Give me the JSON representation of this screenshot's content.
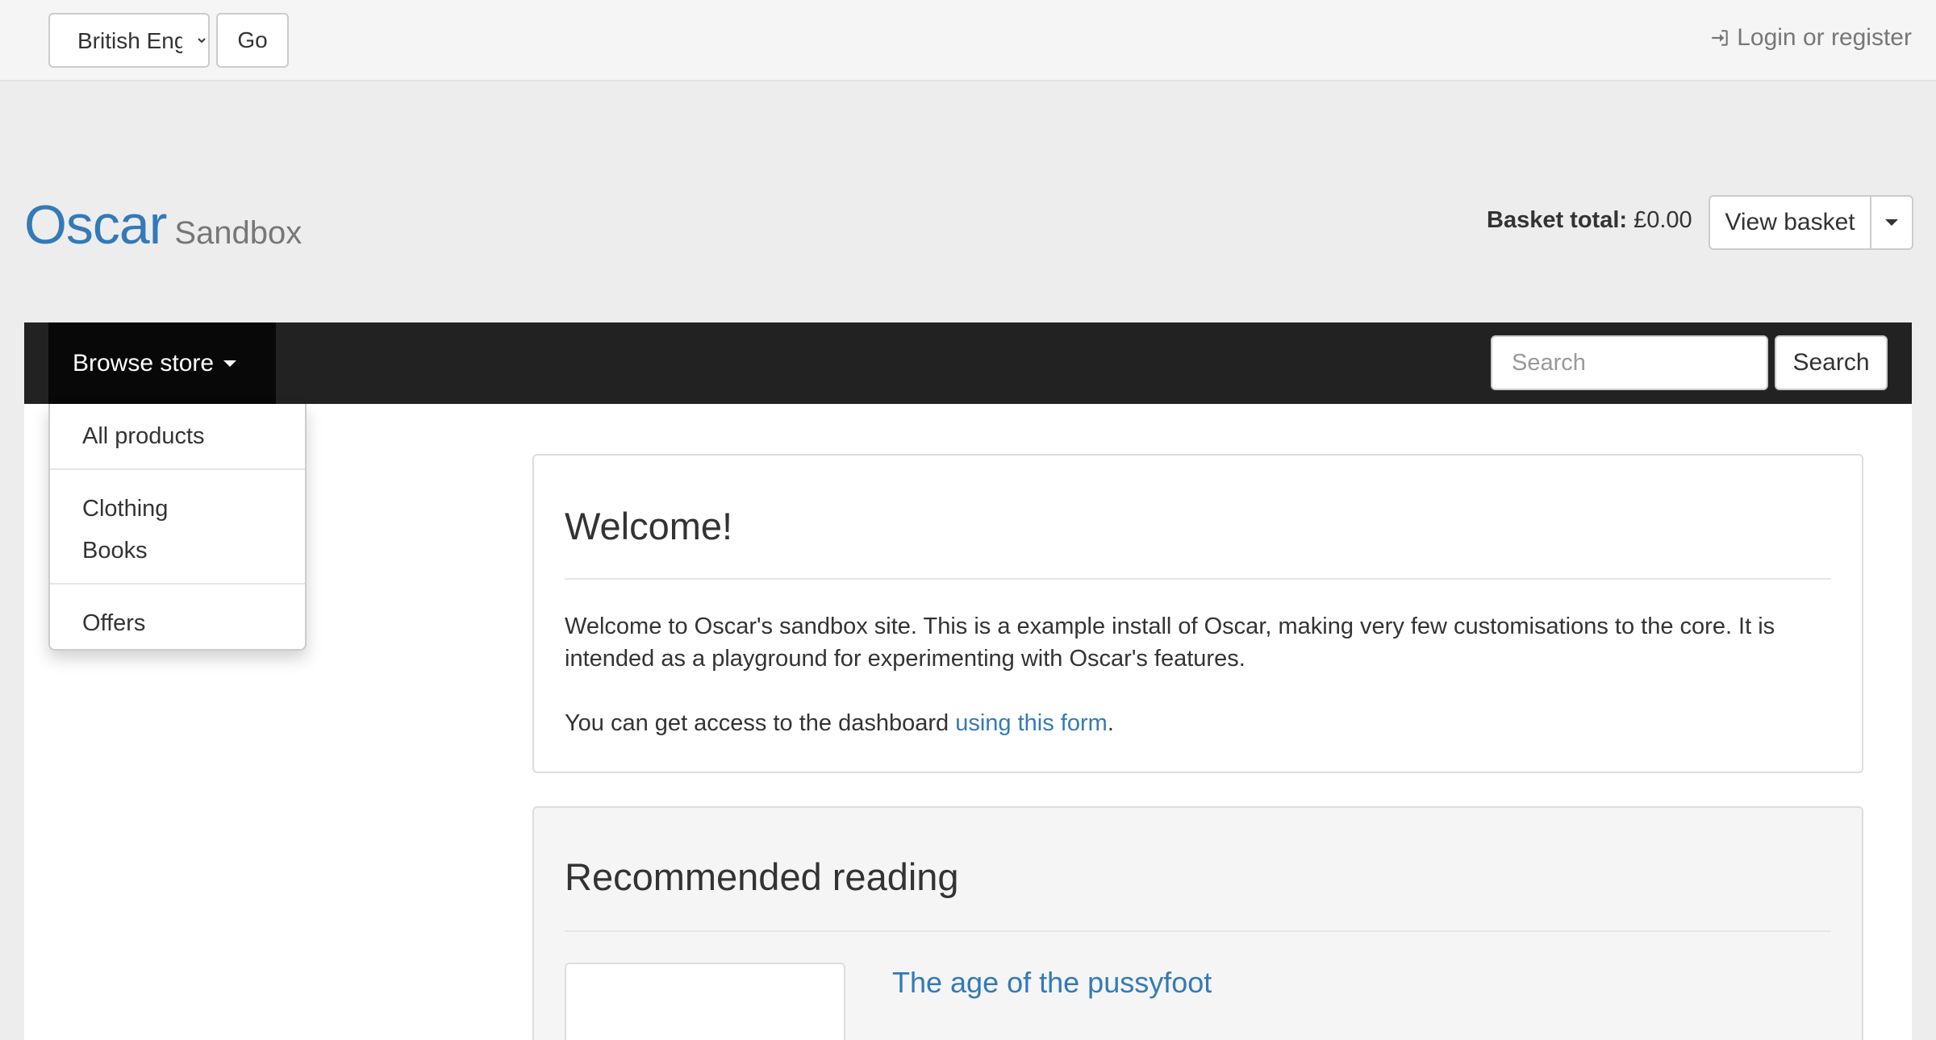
{
  "topbar": {
    "language_selected": "British English",
    "go_label": "Go",
    "login_label": "Login or register"
  },
  "brand": {
    "name": "Oscar",
    "subtitle": "Sandbox"
  },
  "basket": {
    "total_label": "Basket total:",
    "total_value": "£0.00",
    "view_label": "View basket"
  },
  "navbar": {
    "browse_label": "Browse store",
    "search_placeholder": "Search",
    "search_button": "Search"
  },
  "dropdown": {
    "items": [
      "All products",
      "Clothing",
      "Books",
      "Offers"
    ]
  },
  "welcome": {
    "title": "Welcome!",
    "paragraph": "Welcome to Oscar's sandbox site.  This is a example install of Oscar, making very few customisations to the core.  It is intended as a playground for experimenting with Oscar's features.",
    "access_text": "You can get access to the dashboard ",
    "access_link": "using this form",
    "access_end": "."
  },
  "recommended": {
    "title": "Recommended reading",
    "book_title": "The age of the pussyfoot"
  },
  "colors": {
    "brand": "#337ab7",
    "navbar": "#222222",
    "navbar_active": "#080808"
  }
}
